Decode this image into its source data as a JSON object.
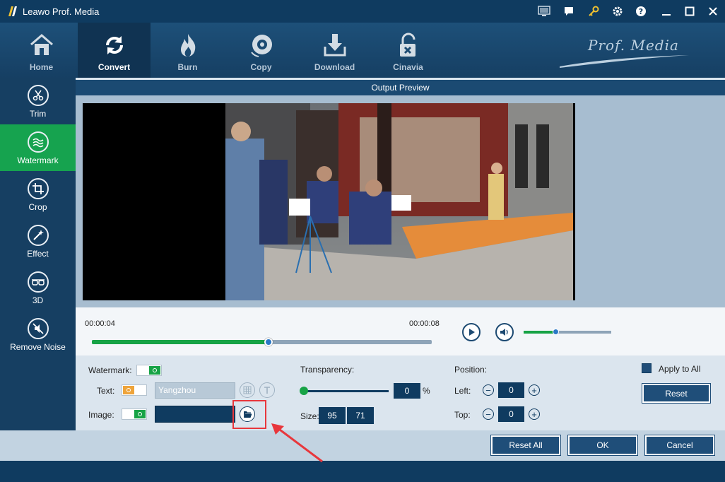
{
  "window": {
    "title": "Leawo Prof. Media",
    "brand": "Prof. Media"
  },
  "nav": {
    "items": [
      {
        "label": "Home",
        "icon": "home-icon"
      },
      {
        "label": "Convert",
        "icon": "convert-icon",
        "active": true
      },
      {
        "label": "Burn",
        "icon": "flame-icon"
      },
      {
        "label": "Copy",
        "icon": "disc-icon"
      },
      {
        "label": "Download",
        "icon": "download-icon"
      },
      {
        "label": "Cinavia",
        "icon": "unlock-icon"
      }
    ]
  },
  "sidebar": {
    "items": [
      {
        "label": "Trim",
        "icon": "scissors-icon"
      },
      {
        "label": "Watermark",
        "icon": "watermark-icon",
        "active": true
      },
      {
        "label": "Crop",
        "icon": "crop-icon"
      },
      {
        "label": "Effect",
        "icon": "effect-wand-icon"
      },
      {
        "label": "3D",
        "icon": "3d-glasses-icon"
      },
      {
        "label": "Remove Noise",
        "icon": "noise-off-icon"
      }
    ]
  },
  "preview": {
    "header": "Output Preview"
  },
  "player": {
    "current_time": "00:00:04",
    "end_time": "00:00:08",
    "progress_fraction": 0.52,
    "volume_fraction": 0.36
  },
  "watermark": {
    "label": "Watermark:",
    "enabled": true,
    "text_label": "Text:",
    "text_value": "Yangzhou",
    "text_enabled": false,
    "image_label": "Image:",
    "image_enabled": true,
    "image_path": ""
  },
  "transparency": {
    "label": "Transparency:",
    "value": "0",
    "unit": "%",
    "size_label": "Size:",
    "width": "95",
    "height": "71"
  },
  "position": {
    "label": "Position:",
    "left_label": "Left:",
    "left_value": "0",
    "top_label": "Top:",
    "top_value": "0"
  },
  "apply": {
    "apply_all_label": "Apply to All",
    "reset_label": "Reset"
  },
  "footer": {
    "reset_all": "Reset All",
    "ok": "OK",
    "cancel": "Cancel"
  },
  "colors": {
    "primary": "#0f3b60",
    "accent_green": "#16a34f",
    "annotation_red": "#e8373c"
  }
}
